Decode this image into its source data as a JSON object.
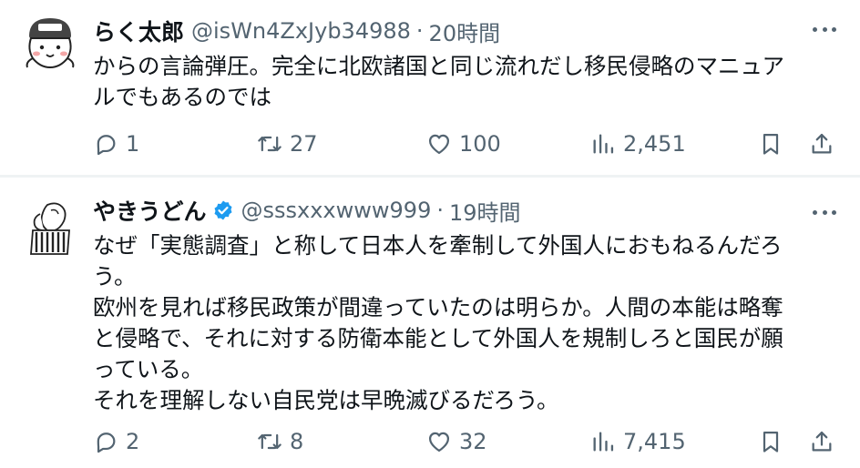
{
  "tweets": [
    {
      "name": "らく太郎",
      "handle": "@isWn4ZxJyb34988",
      "separator": "·",
      "time": "20時間",
      "lines": [
        "からの言論弾圧。完全に北欧諸国と同じ流れだし移民侵略のマニュア",
        "ルでもあるのでは"
      ],
      "stats": {
        "replies": "1",
        "retweets": "27",
        "likes": "100",
        "views": "2,451"
      }
    },
    {
      "name": "やきうどん",
      "verified": true,
      "handle": "@sssxxxwww999",
      "separator": "·",
      "time": "19時間",
      "lines": [
        "なぜ「実態調査」と称して日本人を牽制して外国人におもねるんだろ",
        "う。",
        "欧州を見れば移民政策が間違っていたのは明らか。人間の本能は略奪",
        "と侵略で、それに対する防衛本能として外国人を規制しろと国民が願",
        "っている。",
        "それを理解しない自民党は早晩滅びるだろう。"
      ],
      "stats": {
        "replies": "2",
        "retweets": "8",
        "likes": "32",
        "views": "7,415"
      }
    }
  ],
  "icons": {
    "reply": "reply-icon",
    "retweet": "retweet-icon",
    "like": "heart-icon",
    "views": "views-icon",
    "bookmark": "bookmark-icon",
    "share": "share-icon",
    "more": "more-icon",
    "verified": "verified-badge-icon"
  },
  "colors": {
    "text": "#0f1419",
    "secondary": "#536471",
    "verified": "#1d9bf0",
    "divider": "#eff3f4"
  }
}
